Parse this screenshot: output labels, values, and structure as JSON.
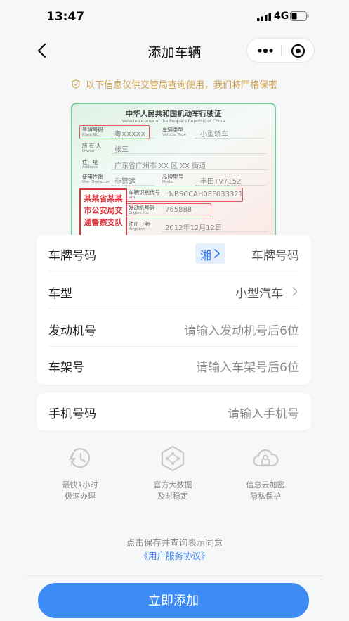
{
  "status": {
    "time": "13:47",
    "network": "4G"
  },
  "nav": {
    "title": "添加车辆"
  },
  "notice": {
    "text": "以下信息仅供交管局查询使用，我们将严格保密"
  },
  "license": {
    "title": "中华人民共和国机动车行驶证",
    "subtitle": "Vehicle License of the People's Republic of China",
    "fields": {
      "plate_no": {
        "cn": "号牌号码",
        "en": "Plate No.",
        "value": "粤XXXXX"
      },
      "vehicle_type": {
        "cn": "车辆类型",
        "en": "Vehicle Type",
        "value": "小型轿车"
      },
      "owner": {
        "cn": "所 有 人",
        "en": "Owner",
        "value": "张三"
      },
      "address": {
        "cn": "住　址",
        "en": "Address",
        "value": "广东省广州市 XX 区 XX 街道"
      },
      "use_character": {
        "cn": "使用性质",
        "en": "Use Character",
        "value": "非营运"
      },
      "model": {
        "cn": "品牌型号",
        "en": "Model",
        "value": "丰田TV7152"
      },
      "vin": {
        "cn": "车辆识别代号",
        "en": "VIN",
        "value": "LNBSCCAH0EF033321"
      },
      "engine_no": {
        "cn": "发动机号码",
        "en": "Engine No.",
        "value": "765888"
      },
      "register": {
        "cn": "注册日期",
        "en": "Register",
        "value": "2012年12月12日"
      }
    },
    "seal_lines": [
      "某某省某某",
      "市公安局交",
      "通警察支队"
    ]
  },
  "form": {
    "plate": {
      "label": "车牌号码",
      "prefix": "湘",
      "placeholder": "车牌号码"
    },
    "vehicle_type": {
      "label": "车型",
      "value": "小型汽车"
    },
    "engine": {
      "label": "发动机号",
      "placeholder": "请输入发动机号后6位"
    },
    "frame": {
      "label": "车架号",
      "placeholder": "请输入车架号后6位"
    },
    "phone": {
      "label": "手机号码",
      "placeholder": "请输入手机号"
    }
  },
  "features": [
    {
      "icon": "lightning-clock-icon",
      "line1": "最快1小时",
      "line2": "极速办理"
    },
    {
      "icon": "data-hexagon-icon",
      "line1": "官方大数据",
      "line2": "及时稳定"
    },
    {
      "icon": "cloud-lock-icon",
      "line1": "信息云加密",
      "line2": "隐私保护"
    }
  ],
  "agreement": {
    "line1": "点击保存并查询表示同意",
    "link": "《用户服务协议》"
  },
  "submit": {
    "label": "立即添加"
  },
  "colors": {
    "primary": "#3d8bf4",
    "notice": "#d0a24a",
    "seal": "#d9363e"
  }
}
